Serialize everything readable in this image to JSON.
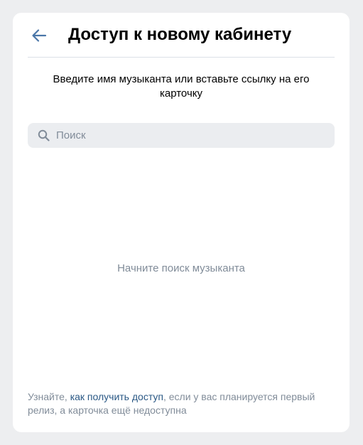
{
  "header": {
    "title": "Доступ к новому кабинету",
    "back_icon": "arrow-left-icon",
    "accent_color": "#4a76a8"
  },
  "instruction": {
    "text": "Введите имя музыканта или вставьте ссылку на его карточку"
  },
  "search": {
    "icon": "search-icon",
    "placeholder": "Поиск",
    "value": ""
  },
  "empty_state": {
    "text": "Начните поиск музыканта"
  },
  "footer": {
    "prefix": "Узнайте, ",
    "link_text": "как получить доступ",
    "suffix": ", если у вас планируется первый релиз, а карточка ещё недоступна",
    "link_color": "#2a5885"
  }
}
